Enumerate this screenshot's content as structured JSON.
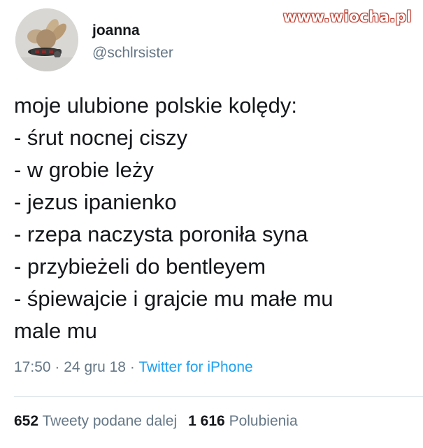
{
  "watermark": "www.wiocha.pl",
  "user": {
    "display_name": "joanna",
    "handle": "@schlrsister"
  },
  "tweet": {
    "lines": [
      "moje ulubione polskie kolędy:",
      "- śrut nocnej ciszy",
      "- w grobie leży",
      "- jezus ipanienko",
      "- rzepa naczysta poroniła syna",
      "- przybieżeli do bentleyem",
      "- śpiewajcie i grajcie mu małe mu",
      "male mu"
    ]
  },
  "meta": {
    "time": "17:50",
    "separator": "·",
    "date": "24 gru 18",
    "source": "Twitter for iPhone"
  },
  "stats": {
    "retweets_count": "652",
    "retweets_label": "Tweety podane dalej",
    "likes_count": "1 616",
    "likes_label": "Polubienia"
  },
  "colors": {
    "text": "#14171a",
    "secondary": "#657786",
    "link": "#1da1f2",
    "watermark_outline": "#c0392b"
  }
}
